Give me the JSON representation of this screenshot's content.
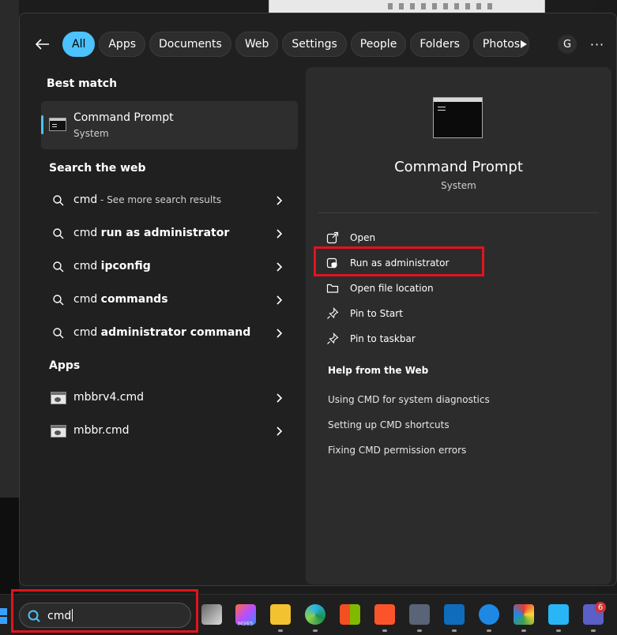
{
  "filters": {
    "tabs": [
      "All",
      "Apps",
      "Documents",
      "Web",
      "Settings",
      "People",
      "Folders",
      "Photos"
    ],
    "active": "All",
    "account_initial": "G",
    "more_label": "···"
  },
  "results": {
    "best_match_heading": "Best match",
    "best_match": {
      "title": "Command Prompt",
      "subtitle": "System"
    },
    "web_heading": "Search the web",
    "web_items": [
      {
        "prefix": "cmd",
        "bold": "",
        "suffix": " - See more search results"
      },
      {
        "prefix": "cmd ",
        "bold": "run as administrator",
        "suffix": ""
      },
      {
        "prefix": "cmd ",
        "bold": "ipconfig",
        "suffix": ""
      },
      {
        "prefix": "cmd ",
        "bold": "commands",
        "suffix": ""
      },
      {
        "prefix": "cmd ",
        "bold": "administrator command",
        "suffix": ""
      }
    ],
    "apps_heading": "Apps",
    "app_items": [
      {
        "label": "mbbrv4.cmd"
      },
      {
        "label": "mbbr.cmd"
      }
    ]
  },
  "preview": {
    "title": "Command Prompt",
    "subtitle": "System",
    "actions": [
      {
        "label": "Open",
        "icon": "open-external-icon"
      },
      {
        "label": "Run as administrator",
        "icon": "shield-admin-icon"
      },
      {
        "label": "Open file location",
        "icon": "folder-icon"
      },
      {
        "label": "Pin to Start",
        "icon": "pin-icon"
      },
      {
        "label": "Pin to taskbar",
        "icon": "pin-icon"
      }
    ],
    "help_heading": "Help from the Web",
    "help_links": [
      "Using CMD for system diagnostics",
      "Setting up CMD shortcuts",
      "Fixing CMD permission errors"
    ]
  },
  "taskbar": {
    "search_value": "cmd",
    "m365_label": "M365",
    "teams_badge": "6"
  },
  "colors": {
    "accent": "#4cc2ff",
    "highlight": "#e0141e",
    "panel": "#202020",
    "preview": "#2c2c2c"
  }
}
